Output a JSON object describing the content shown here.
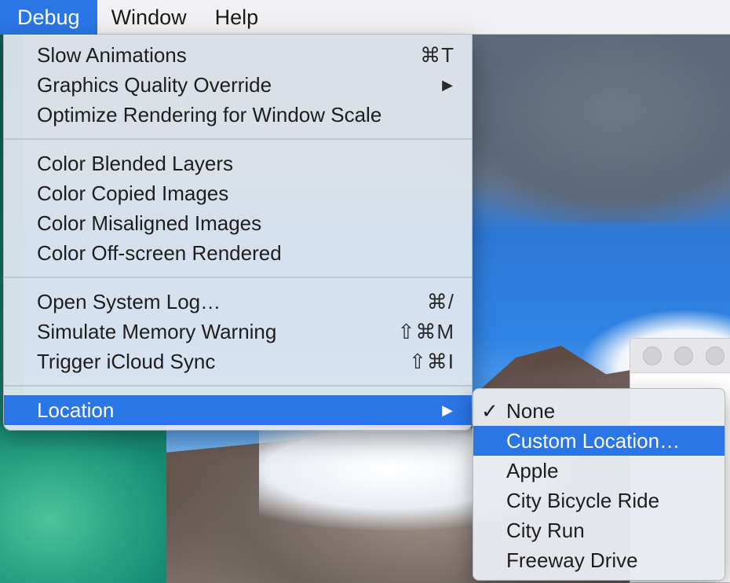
{
  "menubar": {
    "items": [
      {
        "label": "Debug",
        "active": true
      },
      {
        "label": "Window",
        "active": false
      },
      {
        "label": "Help",
        "active": false
      }
    ]
  },
  "debug_menu": {
    "items": [
      {
        "label": "Slow Animations",
        "shortcut": "⌘T"
      },
      {
        "label": "Graphics Quality Override",
        "submenu": true
      },
      {
        "label": "Optimize Rendering for Window Scale"
      },
      {
        "label": "Color Blended Layers"
      },
      {
        "label": "Color Copied Images"
      },
      {
        "label": "Color Misaligned Images"
      },
      {
        "label": "Color Off-screen Rendered"
      },
      {
        "label": "Open System Log…",
        "shortcut": "⌘/"
      },
      {
        "label": "Simulate Memory Warning",
        "shortcut": "⇧⌘M"
      },
      {
        "label": "Trigger iCloud Sync",
        "shortcut": "⇧⌘I"
      },
      {
        "label": "Location",
        "submenu": true,
        "highlighted": true
      }
    ]
  },
  "location_submenu": {
    "items": [
      {
        "label": "None",
        "checked": true
      },
      {
        "label": "Custom Location…",
        "highlighted": true
      },
      {
        "label": "Apple"
      },
      {
        "label": "City Bicycle Ride"
      },
      {
        "label": "City Run"
      },
      {
        "label": "Freeway Drive"
      }
    ],
    "check_glyph": "✓"
  },
  "icons": {
    "submenu_arrow": "▶"
  },
  "colors": {
    "accent": "#2a76e6",
    "menu_bg": "#e2e8ef",
    "menubar_bg": "#f1f1f3"
  }
}
